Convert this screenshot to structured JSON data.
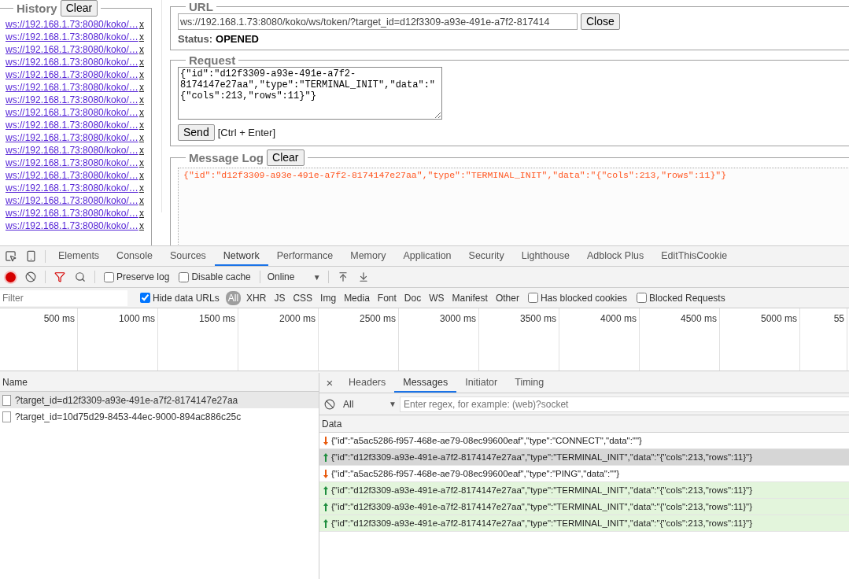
{
  "history": {
    "title": "History",
    "clear_button": "Clear",
    "items": [
      {
        "url": "ws://192.168.1.73:8080/koko/…",
        "remove": "x"
      },
      {
        "url": "ws://192.168.1.73:8080/koko/…",
        "remove": "x"
      },
      {
        "url": "ws://192.168.1.73:8080/koko/…",
        "remove": "x"
      },
      {
        "url": "ws://192.168.1.73:8080/koko/…",
        "remove": "x"
      },
      {
        "url": "ws://192.168.1.73:8080/koko/…",
        "remove": "x"
      },
      {
        "url": "ws://192.168.1.73:8080/koko/…",
        "remove": "x"
      },
      {
        "url": "ws://192.168.1.73:8080/koko/…",
        "remove": "x"
      },
      {
        "url": "ws://192.168.1.73:8080/koko/…",
        "remove": "x"
      },
      {
        "url": "ws://192.168.1.73:8080/koko/…",
        "remove": "x"
      },
      {
        "url": "ws://192.168.1.73:8080/koko/…",
        "remove": "x"
      },
      {
        "url": "ws://192.168.1.73:8080/koko/…",
        "remove": "x"
      },
      {
        "url": "ws://192.168.1.73:8080/koko/…",
        "remove": "x"
      },
      {
        "url": "ws://192.168.1.73:8080/koko/…",
        "remove": "x"
      },
      {
        "url": "ws://192.168.1.73:8080/koko/…",
        "remove": "x"
      },
      {
        "url": "ws://192.168.1.73:8080/koko/…",
        "remove": "x"
      },
      {
        "url": "ws://192.168.1.73:8080/koko/…",
        "remove": "x"
      },
      {
        "url": "ws://192.168.1.73:8080/koko/…",
        "remove": "x"
      }
    ]
  },
  "url_section": {
    "title": "URL",
    "value": "ws://192.168.1.73:8080/koko/ws/token/?target_id=d12f3309-a93e-491e-a7f2-817414",
    "button": "Close",
    "status_label": "Status:",
    "status_value": "OPENED"
  },
  "request_section": {
    "title": "Request",
    "value": "{\"id\":\"d12f3309-a93e-491e-a7f2-8174147e27aa\",\"type\":\"TERMINAL_INIT\",\"data\":\"{\"cols\":213,\"rows\":11}\"}",
    "send_button": "Send",
    "hint": "[Ctrl + Enter]"
  },
  "message_log": {
    "title": "Message Log",
    "clear_button": "Clear",
    "entries": [
      "{\"id\":\"d12f3309-a93e-491e-a7f2-8174147e27aa\",\"type\":\"TERMINAL_INIT\",\"data\":\"{\"cols\":213,\"rows\":11}\"}"
    ]
  },
  "devtools": {
    "tabs": [
      {
        "label": "Elements",
        "selected": false
      },
      {
        "label": "Console",
        "selected": false
      },
      {
        "label": "Sources",
        "selected": false
      },
      {
        "label": "Network",
        "selected": true
      },
      {
        "label": "Performance",
        "selected": false
      },
      {
        "label": "Memory",
        "selected": false
      },
      {
        "label": "Application",
        "selected": false
      },
      {
        "label": "Security",
        "selected": false
      },
      {
        "label": "Lighthouse",
        "selected": false
      },
      {
        "label": "Adblock Plus",
        "selected": false
      },
      {
        "label": "EditThisCookie",
        "selected": false
      }
    ],
    "toolbar": {
      "recording": true,
      "preserve_log": {
        "label": "Preserve log",
        "checked": false
      },
      "disable_cache": {
        "label": "Disable cache",
        "checked": false
      },
      "throttling": {
        "value": "Online",
        "caret": "▼"
      }
    },
    "filter": {
      "placeholder": "Filter",
      "hide_data_urls": {
        "label": "Hide data URLs",
        "checked": true
      },
      "types": [
        {
          "label": "All",
          "selected": true
        },
        {
          "label": "XHR",
          "selected": false
        },
        {
          "label": "JS",
          "selected": false
        },
        {
          "label": "CSS",
          "selected": false
        },
        {
          "label": "Img",
          "selected": false
        },
        {
          "label": "Media",
          "selected": false
        },
        {
          "label": "Font",
          "selected": false
        },
        {
          "label": "Doc",
          "selected": false
        },
        {
          "label": "WS",
          "selected": false
        },
        {
          "label": "Manifest",
          "selected": false
        },
        {
          "label": "Other",
          "selected": false
        }
      ],
      "has_blocked_cookies": {
        "label": "Has blocked cookies",
        "checked": false
      },
      "blocked_requests": {
        "label": "Blocked Requests",
        "checked": false
      }
    },
    "timeline": {
      "ticks": [
        "500 ms",
        "1000 ms",
        "1500 ms",
        "2000 ms",
        "2500 ms",
        "3000 ms",
        "3500 ms",
        "4000 ms",
        "4500 ms",
        "5000 ms",
        "55"
      ]
    },
    "requests": {
      "column": "Name",
      "rows": [
        {
          "name": "?target_id=d12f3309-a93e-491e-a7f2-8174147e27aa",
          "selected": true
        },
        {
          "name": "?target_id=10d75d29-8453-44ec-9000-894ac886c25c",
          "selected": false
        }
      ]
    },
    "detail": {
      "close": "×",
      "tabs": [
        {
          "label": "Headers",
          "selected": false
        },
        {
          "label": "Messages",
          "selected": true
        },
        {
          "label": "Initiator",
          "selected": false
        },
        {
          "label": "Timing",
          "selected": false
        }
      ],
      "message_filter": {
        "type": "All",
        "caret": "▼",
        "placeholder": "Enter regex, for example: (web)?socket"
      },
      "column": "Data",
      "messages": [
        {
          "kind": "received",
          "selected": false,
          "text": "{\"id\":\"a5ac5286-f957-468e-ae79-08ec99600eaf\",\"type\":\"CONNECT\",\"data\":\"\"}"
        },
        {
          "kind": "sent",
          "selected": true,
          "text": "{\"id\":\"d12f3309-a93e-491e-a7f2-8174147e27aa\",\"type\":\"TERMINAL_INIT\",\"data\":\"{\"cols\":213,\"rows\":11}\"}"
        },
        {
          "kind": "received",
          "selected": false,
          "text": "{\"id\":\"a5ac5286-f957-468e-ae79-08ec99600eaf\",\"type\":\"PING\",\"data\":\"\"}"
        },
        {
          "kind": "sent",
          "selected": false,
          "text": "{\"id\":\"d12f3309-a93e-491e-a7f2-8174147e27aa\",\"type\":\"TERMINAL_INIT\",\"data\":\"{\"cols\":213,\"rows\":11}\"}"
        },
        {
          "kind": "sent",
          "selected": false,
          "text": "{\"id\":\"d12f3309-a93e-491e-a7f2-8174147e27aa\",\"type\":\"TERMINAL_INIT\",\"data\":\"{\"cols\":213,\"rows\":11}\"}"
        },
        {
          "kind": "sent",
          "selected": false,
          "text": "{\"id\":\"d12f3309-a93e-491e-a7f2-8174147e27aa\",\"type\":\"TERMINAL_INIT\",\"data\":\"{\"cols\":213,\"rows\":11}\"}"
        }
      ]
    }
  }
}
